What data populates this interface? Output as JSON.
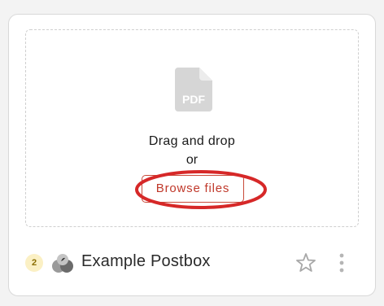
{
  "upload": {
    "file_type_label": "PDF",
    "drag_text": "Drag and drop",
    "or_text": "or",
    "browse_label": "Browse files"
  },
  "footer": {
    "count": "2",
    "postbox_name": "Example Postbox"
  },
  "icons": {
    "file": "pdf-file-icon",
    "postbox": "postbox-logo-icon",
    "favorite": "star-outline-icon",
    "menu": "vertical-dots-icon"
  },
  "colors": {
    "accent": "#c0392b",
    "highlight": "#d62828",
    "badge_bg": "#fbf0c4",
    "icon_gray": "#d6d6d6"
  }
}
